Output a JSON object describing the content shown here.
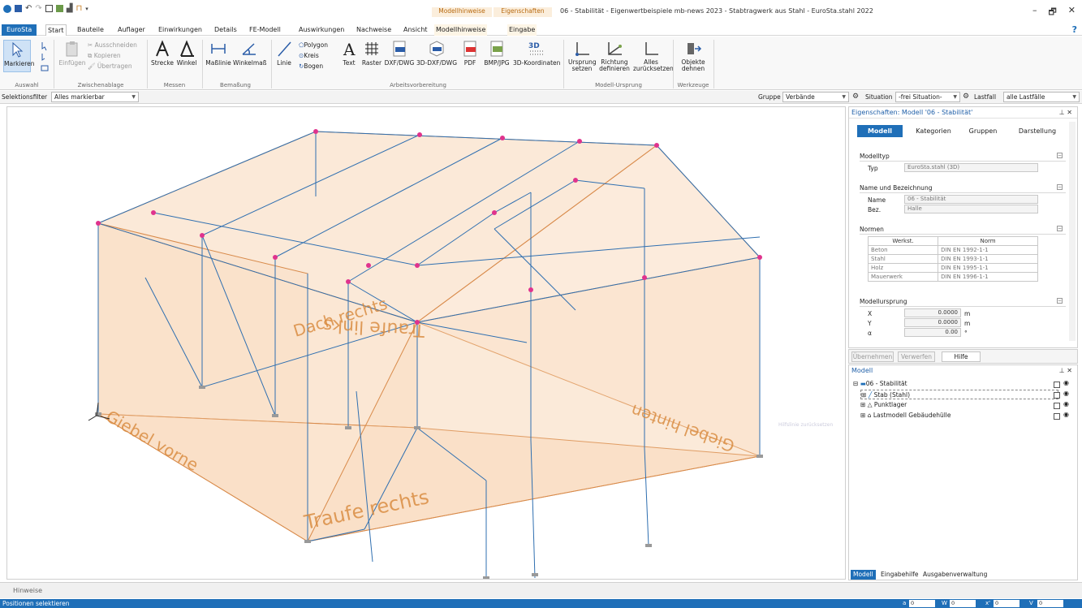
{
  "window": {
    "title": "06 - Stabilität - Eigenwertbeispiele mb-news 2023 - Stabtragwerk aus Stahl - EuroSta.stahl 2022",
    "context_tabs": [
      "Modellhinweise",
      "Eigenschaften"
    ],
    "controls": [
      "–",
      "🗗",
      "✕"
    ]
  },
  "tabs": [
    "EuroSta",
    "Start",
    "Bauteile",
    "Auflager",
    "Einwirkungen",
    "Details",
    "FE-Modell",
    "Auswirkungen",
    "Nachweise",
    "Ansicht",
    "Modellhinweise",
    "Eingabe"
  ],
  "ribbon": {
    "auswahl": {
      "markieren": "Markieren",
      "group": "Auswahl"
    },
    "zwischenablage": {
      "einfuegen": "Einfügen",
      "ausschneiden": "Ausschneiden",
      "kopieren": "Kopieren",
      "uebertragen": "Übertragen",
      "group": "Zwischenablage"
    },
    "messen": {
      "strecke": "Strecke",
      "winkel": "Winkel",
      "group": "Messen"
    },
    "bemassung": {
      "masslinie": "Maßlinie",
      "winkelmass": "Winkelmaß",
      "group": "Bemaßung"
    },
    "arbeitsvorbereitung": {
      "linie": "Linie",
      "polygon": "Polygon",
      "kreis": "Kreis",
      "bogen": "Bogen",
      "text": "Text",
      "raster": "Raster",
      "dxf": "DXF/DWG",
      "dxf3d": "3D-DXF/DWG",
      "pdf": "PDF",
      "bmp": "BMP/JPG",
      "koord3d": "3D-Koordinaten",
      "group": "Arbeitsvorbereitung"
    },
    "modellursprung": {
      "ursprung": "Ursprung setzen",
      "richtung": "Richtung definieren",
      "alles": "Alles zurücksetzen",
      "group": "Modell-Ursprung"
    },
    "werkzeuge": {
      "objekte": "Objekte dehnen",
      "group": "Werkzeuge"
    }
  },
  "selbar": {
    "selektionsfilter_label": "Selektionsfilter",
    "selektionsfilter_value": "Alles markierbar",
    "gruppe_label": "Gruppe",
    "gruppe_value": "Verbände",
    "situation_label": "Situation",
    "situation_value": "-frei Situation-",
    "lastfall_label": "Lastfall",
    "lastfall_value": "alle Lastfälle"
  },
  "viewport": {
    "labels": [
      "Dach rechts",
      "Traufe links",
      "Giebel vorne",
      "Giebel hinten",
      "Traufe rechts"
    ],
    "tooltip": "Hilfslinie zurücksetzen"
  },
  "properties": {
    "header": "Eigenschaften: Modell '06 - Stabilität'",
    "tabs": [
      "Modell",
      "Kategorien",
      "Gruppen",
      "Darstellung"
    ],
    "modelltyp": {
      "title": "Modelltyp",
      "typ_label": "Typ",
      "typ_value": "EuroSta.stahl (3D)"
    },
    "name": {
      "title": "Name und Bezeichnung",
      "name_label": "Name",
      "name_value": "06 - Stabilität",
      "bez_label": "Bez.",
      "bez_value": "Halle"
    },
    "normen": {
      "title": "Normen",
      "headers": [
        "Werkst.",
        "Norm"
      ],
      "rows": [
        [
          "Beton",
          "DIN EN 1992-1-1"
        ],
        [
          "Stahl",
          "DIN EN 1993-1-1"
        ],
        [
          "Holz",
          "DIN EN 1995-1-1"
        ],
        [
          "Mauerwerk",
          "DIN EN 1996-1-1"
        ]
      ]
    },
    "ursprung": {
      "title": "Modellursprung",
      "x_label": "X",
      "x_value": "0.0000",
      "x_unit": "m",
      "y_label": "Y",
      "y_value": "0.0000",
      "y_unit": "m",
      "a_label": "α",
      "a_value": "0.00",
      "a_unit": "°"
    },
    "buttons": {
      "uebernehmen": "Übernehmen",
      "verwerfen": "Verwerfen",
      "hilfe": "Hilfe"
    }
  },
  "tree": {
    "header": "Modell",
    "root": "06 - Stabilität",
    "items": [
      "Stab (Stahl)",
      "Punktlager",
      "Lastmodell Gebäudehülle"
    ],
    "bottom_tabs": [
      "Modell",
      "Eingabehilfe",
      "Ausgabenverwaltung"
    ]
  },
  "hinweise": "Hinweise",
  "status": {
    "text": "Positionen selektieren",
    "fields": [
      {
        "label": "a",
        "value": "0"
      },
      {
        "label": "W",
        "value": "0"
      },
      {
        "label": "x'",
        "value": "0"
      },
      {
        "label": "V",
        "value": "0"
      }
    ]
  },
  "colors": {
    "accent": "#1f6fb8",
    "context": "#b86a10",
    "surface": "#f6c79d",
    "member": "#2f6fb0"
  }
}
